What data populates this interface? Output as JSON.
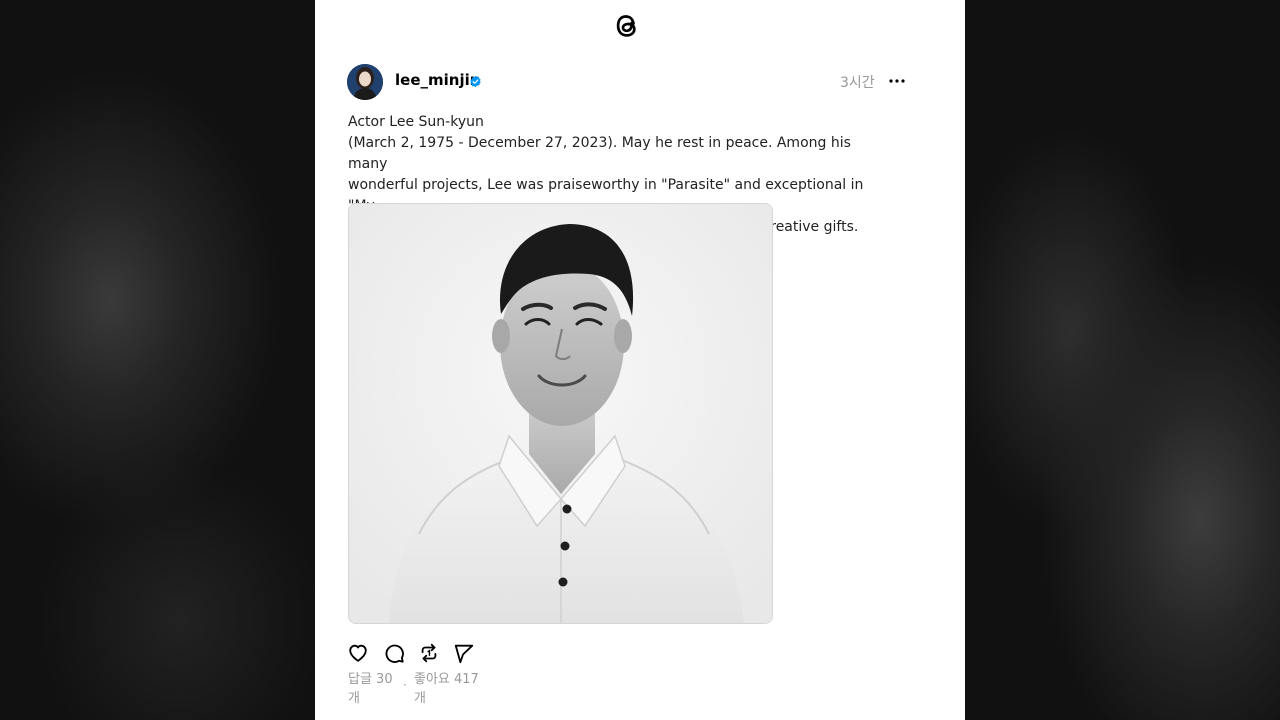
{
  "post": {
    "username": "lee_minjin",
    "time": "3시간",
    "text_lines": [
      "Actor Lee Sun-kyun",
      "(March 2, 1975 - December 27, 2023). May he rest in peace. Among his many",
      "wonderful projects, Lee was praiseworthy in \"Parasite\" and exceptional in \"My",
      "Mister.\" May he be remembered for his excellent work and creative gifts."
    ],
    "replies_label": "답글 30",
    "replies_unit": "개",
    "likes_label": "좋아요 417",
    "likes_unit": "개",
    "dot": "·"
  },
  "icons": {
    "logo": "threads-logo",
    "verified": "verified-badge-icon",
    "more": "more-options-icon",
    "like": "heart-icon",
    "reply": "comment-icon",
    "repost": "repost-icon",
    "share": "send-icon"
  },
  "colors": {
    "verified": "#0095f6",
    "secondary_text": "#999999",
    "page_bg": "#ffffff"
  }
}
